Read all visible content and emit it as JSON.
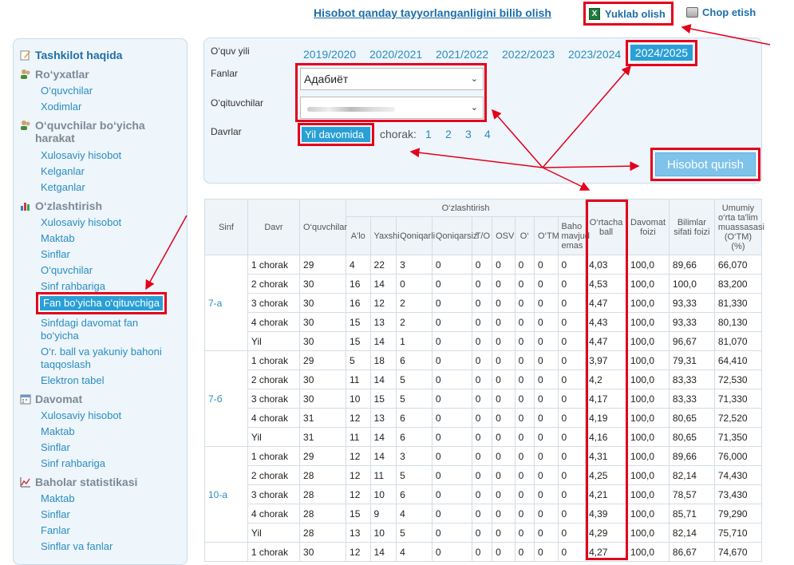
{
  "top": {
    "how_link": "Hisobot qanday tayyorlanganligini bilib olish",
    "download": "Yuklab olish",
    "print": "Chop etish"
  },
  "sidebar": {
    "sections": [
      {
        "title": "Tashkilot haqida",
        "icon": "edit-icon",
        "items": []
      },
      {
        "title": "Ro‘yxatlar",
        "icon": "users-icon",
        "items": [
          "O‘quvchilar",
          "Xodimlar"
        ]
      },
      {
        "title": "O‘quvchilar bo‘yicha harakat",
        "icon": "users-icon",
        "items": [
          "Xulosaviy hisobot",
          "Kelganlar",
          "Ketganlar"
        ]
      },
      {
        "title": "O‘zlashtirish",
        "icon": "bar-chart-icon",
        "items": [
          "Xulosaviy hisobot",
          "Maktab",
          "Sinflar",
          "O‘quvchilar",
          "Sinf rahbariga",
          "Fan bo‘yicha o‘qituvchiga",
          "Sinfdagi davomat fan bo‘yicha",
          "O‘r. ball va yakuniy bahoni taqqoslash",
          "Elektron tabel"
        ]
      },
      {
        "title": "Davomat",
        "icon": "calendar-icon",
        "items": [
          "Xulosaviy hisobot",
          "Maktab",
          "Sinflar",
          "Sinf rahbariga"
        ]
      },
      {
        "title": "Baholar statistikasi",
        "icon": "stats-icon",
        "items": [
          "Maktab",
          "Sinflar",
          "Fanlar",
          "Sinflar va fanlar"
        ]
      }
    ]
  },
  "filter": {
    "year_label": "O‘quv yili",
    "years": [
      "2019/2020",
      "2020/2021",
      "2021/2022",
      "2022/2023",
      "2023/2024",
      "2024/2025"
    ],
    "subjects_label": "Fanlar",
    "subject_value": "Адабиёт",
    "teachers_label": "O‘qituvchilar",
    "periods_label": "Davrlar",
    "period_active": "Yil davomida",
    "chorak_label": "chorak:",
    "quarters": [
      "1",
      "2",
      "3",
      "4"
    ],
    "build_button": "Hisobot qurish"
  },
  "table": {
    "headers": {
      "sinf": "Sinf",
      "davr": "Davr",
      "oquvchilar": "O‘quvchilar",
      "ozlashtirish": "O‘zlashtirish",
      "alo": "A'lo",
      "yaxshi": "Yaxshi",
      "qoniqarli": "Qoniqarli",
      "qoniqarsiz": "Qoniqarsiz",
      "to": "T/O",
      "osv": "OSV",
      "o": "O‘",
      "otm": "O‘TM",
      "baho": "Baho mavjud emas",
      "ball": "O‘rtacha ball",
      "davomat": "Davomat foizi",
      "bilim": "Bilimlar sifati foizi",
      "umumiy": "Umumiy o‘rta ta'lim muassasasi (O‘TM) (%)"
    },
    "groups": [
      {
        "sinf": "7-a",
        "rows": [
          [
            "1 chorak",
            "29",
            "4",
            "22",
            "3",
            "0",
            "0",
            "0",
            "0",
            "0",
            "0",
            "4,03",
            "100,0",
            "89,66",
            "66,070"
          ],
          [
            "2 chorak",
            "30",
            "16",
            "14",
            "0",
            "0",
            "0",
            "0",
            "0",
            "0",
            "0",
            "4,53",
            "100,0",
            "100,0",
            "83,200"
          ],
          [
            "3 chorak",
            "30",
            "16",
            "12",
            "2",
            "0",
            "0",
            "0",
            "0",
            "0",
            "0",
            "4,47",
            "100,0",
            "93,33",
            "81,330"
          ],
          [
            "4 chorak",
            "30",
            "15",
            "13",
            "2",
            "0",
            "0",
            "0",
            "0",
            "0",
            "0",
            "4,43",
            "100,0",
            "93,33",
            "80,130"
          ],
          [
            "Yil",
            "30",
            "15",
            "14",
            "1",
            "0",
            "0",
            "0",
            "0",
            "0",
            "0",
            "4,47",
            "100,0",
            "96,67",
            "81,070"
          ]
        ]
      },
      {
        "sinf": "7-б",
        "rows": [
          [
            "1 chorak",
            "29",
            "5",
            "18",
            "6",
            "0",
            "0",
            "0",
            "0",
            "0",
            "0",
            "3,97",
            "100,0",
            "79,31",
            "64,410"
          ],
          [
            "2 chorak",
            "30",
            "11",
            "14",
            "5",
            "0",
            "0",
            "0",
            "0",
            "0",
            "0",
            "4,2",
            "100,0",
            "83,33",
            "72,530"
          ],
          [
            "3 chorak",
            "30",
            "10",
            "15",
            "5",
            "0",
            "0",
            "0",
            "0",
            "0",
            "0",
            "4,17",
            "100,0",
            "83,33",
            "71,330"
          ],
          [
            "4 chorak",
            "31",
            "12",
            "13",
            "6",
            "0",
            "0",
            "0",
            "0",
            "0",
            "0",
            "4,19",
            "100,0",
            "80,65",
            "72,520"
          ],
          [
            "Yil",
            "31",
            "11",
            "14",
            "6",
            "0",
            "0",
            "0",
            "0",
            "0",
            "0",
            "4,16",
            "100,0",
            "80,65",
            "71,350"
          ]
        ]
      },
      {
        "sinf": "10-a",
        "rows": [
          [
            "1 chorak",
            "29",
            "12",
            "14",
            "3",
            "0",
            "0",
            "0",
            "0",
            "0",
            "0",
            "4,31",
            "100,0",
            "89,66",
            "76,000"
          ],
          [
            "2 chorak",
            "28",
            "12",
            "11",
            "5",
            "0",
            "0",
            "0",
            "0",
            "0",
            "0",
            "4,25",
            "100,0",
            "82,14",
            "74,430"
          ],
          [
            "3 chorak",
            "28",
            "12",
            "10",
            "6",
            "0",
            "0",
            "0",
            "0",
            "0",
            "0",
            "4,21",
            "100,0",
            "78,57",
            "73,430"
          ],
          [
            "4 chorak",
            "28",
            "15",
            "9",
            "4",
            "0",
            "0",
            "0",
            "0",
            "0",
            "0",
            "4,39",
            "100,0",
            "85,71",
            "79,290"
          ],
          [
            "Yil",
            "28",
            "13",
            "10",
            "5",
            "0",
            "0",
            "0",
            "0",
            "0",
            "0",
            "4,29",
            "100,0",
            "82,14",
            "75,710"
          ]
        ]
      },
      {
        "sinf": "",
        "rows": [
          [
            "1 chorak",
            "30",
            "12",
            "14",
            "4",
            "0",
            "0",
            "0",
            "0",
            "0",
            "0",
            "4,27",
            "100,0",
            "86,67",
            "74,670"
          ]
        ]
      }
    ]
  },
  "colors": {
    "highlight": "#e3001b",
    "accent": "#2a9fd6",
    "link": "#2a8ec0"
  }
}
